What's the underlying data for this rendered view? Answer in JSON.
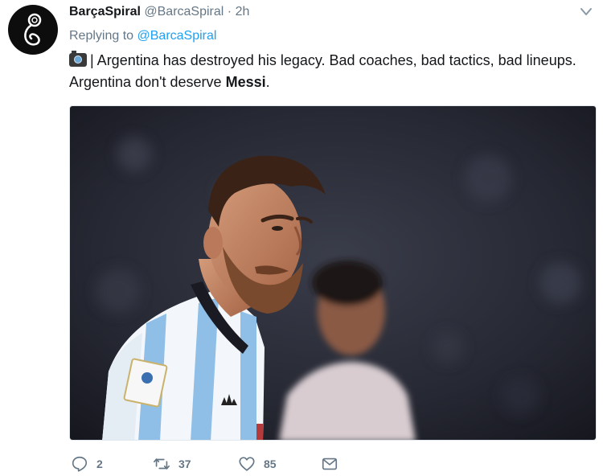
{
  "tweet": {
    "display_name": "BarçaSpiral",
    "handle": "@BarcaSpiral",
    "separator": "·",
    "time": "2h",
    "reply_prefix": "Replying to",
    "reply_to": "@BarcaSpiral",
    "text_part1": "| Argentina has destroyed his legacy. Bad coaches, bad tactics, bad lineups. Argentina don't deserve",
    "text_bold": "Messi",
    "text_end": "."
  },
  "actions": {
    "replies": "2",
    "retweets": "37",
    "likes": "85"
  },
  "icons": {
    "avatar": "spiral-logo",
    "menu": "chevron-down-icon",
    "camera": "camera-emoji",
    "reply": "reply-icon",
    "retweet": "retweet-icon",
    "like": "heart-icon",
    "message": "envelope-icon"
  },
  "colors": {
    "link": "#1da1f2",
    "meta": "#657786",
    "text": "#14171a"
  }
}
